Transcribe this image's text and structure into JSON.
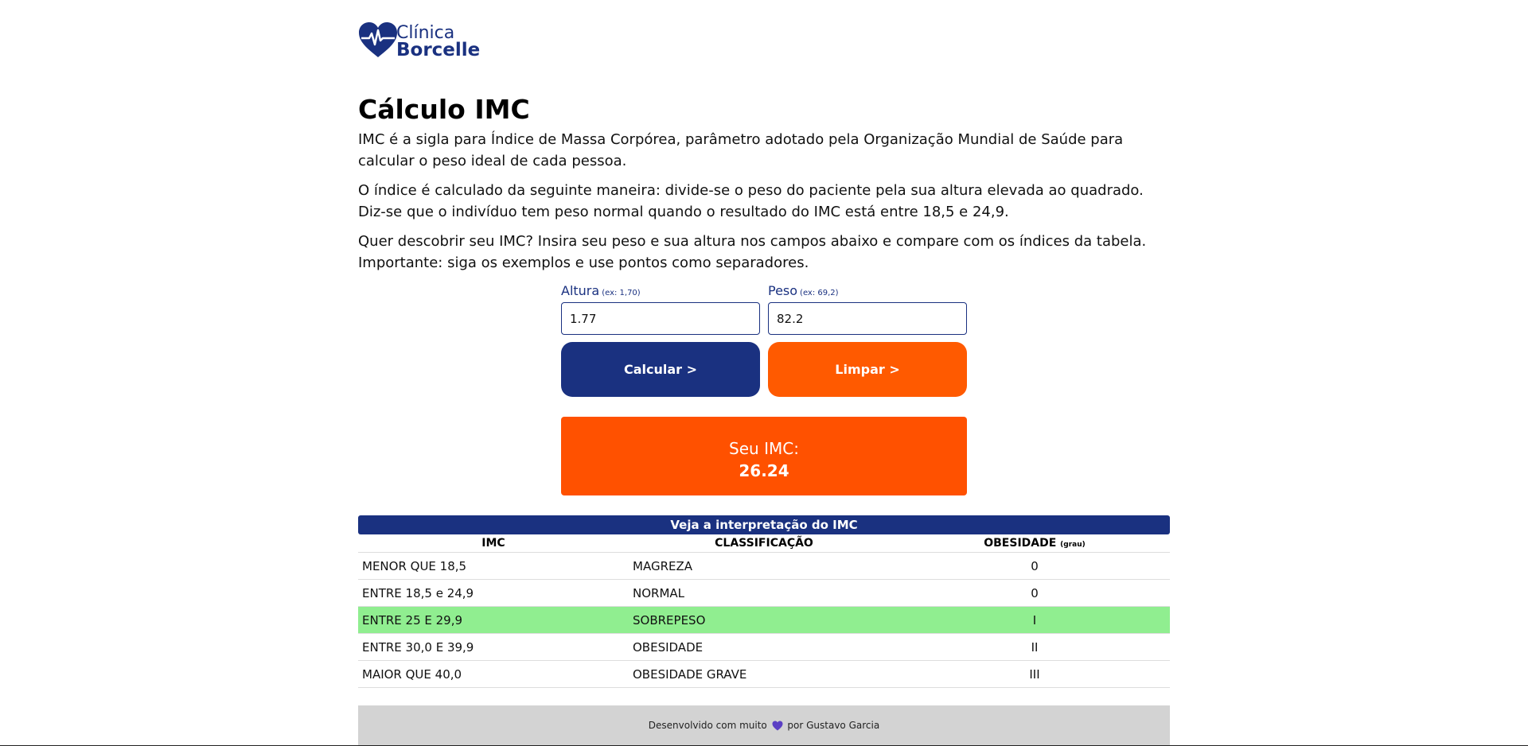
{
  "brand": {
    "line1": "Clínica",
    "line2": "Borcelle",
    "color": "#1a3180"
  },
  "page": {
    "title": "Cálculo IMC",
    "paragraphs": [
      "IMC é a sigla para Índice de Massa Corpórea, parâmetro adotado pela Organização Mundial de Saúde para calcular o peso ideal de cada pessoa.",
      "O índice é calculado da seguinte maneira: divide-se o peso do paciente pela sua altura elevada ao quadrado. Diz-se que o indivíduo tem peso normal quando o resultado do IMC está entre 18,5 e 24,9.",
      "Quer descobrir seu IMC? Insira seu peso e sua altura nos campos abaixo e compare com os índices da tabela. Importante: siga os exemplos e use pontos como separadores."
    ]
  },
  "form": {
    "height_label": "Altura",
    "height_hint": "(ex: 1,70)",
    "height_value": "1.77",
    "weight_label": "Peso",
    "weight_hint": "(ex: 69,2)",
    "weight_value": "82.2",
    "calc_button": "Calcular >",
    "clear_button": "Limpar >"
  },
  "result": {
    "label": "Seu IMC:",
    "value": "26.24"
  },
  "table": {
    "caption": "Veja a interpretação do IMC",
    "headers": {
      "imc": "IMC",
      "class": "CLASSIFICAÇÃO",
      "obesity": "OBESIDADE",
      "obesity_small": "(grau)"
    },
    "rows": [
      {
        "imc": "MENOR QUE 18,5",
        "class": "MAGREZA",
        "grade": "0"
      },
      {
        "imc": "ENTRE 18,5 e 24,9",
        "class": "NORMAL",
        "grade": "0"
      },
      {
        "imc": "ENTRE 25 E 29,9",
        "class": "SOBREPESO",
        "grade": "I"
      },
      {
        "imc": "ENTRE 30,0 E 39,9",
        "class": "OBESIDADE",
        "grade": "II"
      },
      {
        "imc": "MAIOR QUE 40,0",
        "class": "OBESIDADE GRAVE",
        "grade": "III"
      }
    ],
    "highlight_color": "#90ee90"
  },
  "footer": {
    "prefix": "Desenvolvido com muito",
    "suffix": "por Gustavo Garcia"
  },
  "colors": {
    "primary": "#1a3180",
    "accent": "#ff5100"
  }
}
